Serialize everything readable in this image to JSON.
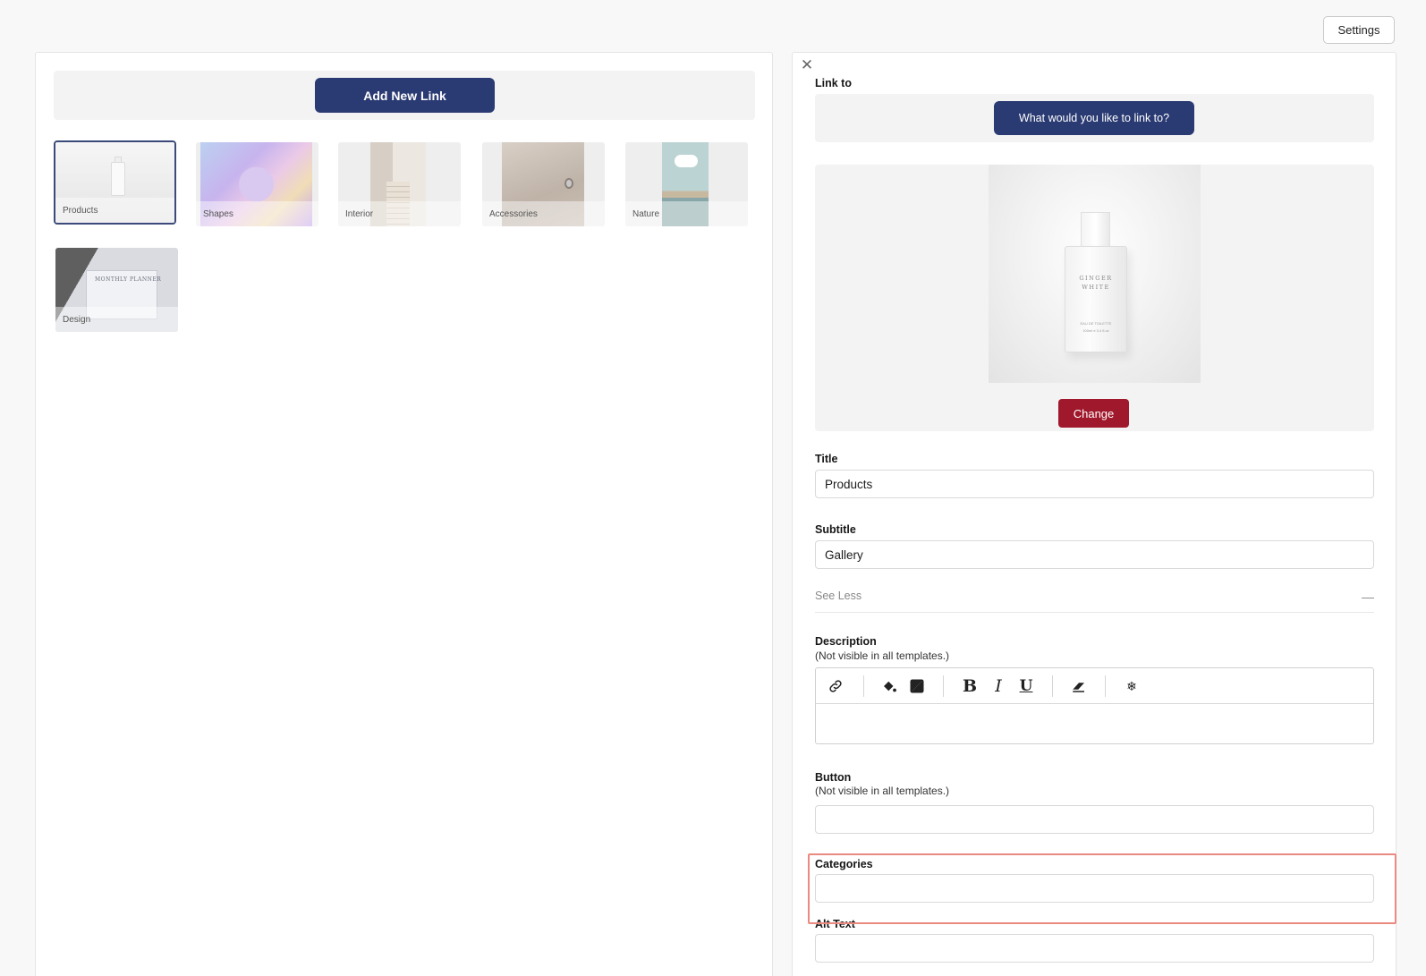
{
  "header": {
    "settings_label": "Settings"
  },
  "left": {
    "add_link_label": "Add New Link",
    "tiles": [
      {
        "label": "Products",
        "selected": true
      },
      {
        "label": "Shapes"
      },
      {
        "label": "Interior"
      },
      {
        "label": "Accessories"
      },
      {
        "label": "Nature"
      },
      {
        "label": "Design",
        "image_text": "MONTHLY PLANNER"
      }
    ]
  },
  "editor": {
    "close_icon": "close-icon",
    "link_to_label": "Link to",
    "link_to_button": "What would you like to link to?",
    "preview": {
      "brand_line1": "GINGER",
      "brand_line2": "WHITE",
      "small_line1": "EAU DE TOILETTE",
      "small_line2": "100ml e 3.4 fl.oz"
    },
    "change_label": "Change",
    "title_label": "Title",
    "title_value": "Products",
    "subtitle_label": "Subtitle",
    "subtitle_value": "Gallery",
    "see_less_label": "See Less",
    "see_less_icon": "—",
    "description_label": "Description",
    "description_note": "(Not visible in all templates.)",
    "toolbar": [
      "link-icon",
      "fill-color-icon",
      "contrast-icon",
      "bold-icon",
      "italic-icon",
      "underline-icon",
      "eraser-icon",
      "snowflake-icon"
    ],
    "toolbar_glyphs": {
      "bold": "B",
      "italic": "I",
      "underline": "U",
      "snowflake": "❄"
    },
    "button_label": "Button",
    "button_note": "(Not visible in all templates.)",
    "button_value": "",
    "categories_label": "Categories",
    "categories_value": "",
    "alt_text_label": "Alt Text",
    "alt_text_value": ""
  },
  "colors": {
    "primary": "#2a3a72",
    "danger": "#a0182b",
    "highlight": "#ea8a80"
  }
}
